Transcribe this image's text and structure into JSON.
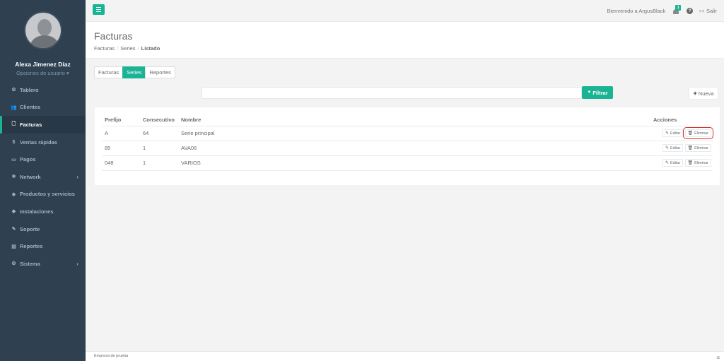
{
  "sidebar": {
    "user_name": "Alexa Jimenez Díaz",
    "user_options": "Opciones de usuario ▾",
    "items": [
      {
        "icon": "⚙",
        "label": "Tablero"
      },
      {
        "icon": "👥",
        "label": "Clientes"
      },
      {
        "icon": "🗋",
        "label": "Facturas"
      },
      {
        "icon": "$",
        "label": "Ventas rápidas"
      },
      {
        "icon": "▭",
        "label": "Pagos"
      },
      {
        "icon": "❄",
        "label": "Network",
        "chevron": "‹"
      },
      {
        "icon": "◈",
        "label": "Productos y servicios"
      },
      {
        "icon": "◆",
        "label": "Instalaciones"
      },
      {
        "icon": "✎",
        "label": "Soporte"
      },
      {
        "icon": "▤",
        "label": "Reportes"
      },
      {
        "icon": "⚙",
        "label": "Sistema",
        "chevron": "‹"
      }
    ]
  },
  "topbar": {
    "welcome": "Bienvenido a ArgusBlack",
    "notif_count": "1",
    "help": "?",
    "logout": "Salir",
    "logout_icon": "↦"
  },
  "heading": {
    "title": "Facturas",
    "crumb1": "Facturas",
    "crumb2": "Series",
    "crumb3": "Listado",
    "sep": "/"
  },
  "tabs": [
    "Facturas",
    "Series",
    "Reportes"
  ],
  "filter": {
    "placeholder": "",
    "button": "Filtrar",
    "button_icon": "▼",
    "new_button": "Nueva",
    "new_icon": "+"
  },
  "table": {
    "headers": [
      "Prefijo",
      "Consecutivo",
      "Nombre",
      "Acciones"
    ],
    "rows": [
      {
        "prefijo": "A",
        "consecutivo": "64",
        "nombre": "Serie principal"
      },
      {
        "prefijo": "85",
        "consecutivo": "1",
        "nombre": "AVA06"
      },
      {
        "prefijo": "048",
        "consecutivo": "1",
        "nombre": "VARIOS"
      }
    ],
    "edit_label": "Editar",
    "edit_icon": "✎",
    "delete_label": "Eliminar",
    "delete_icon": "🗑"
  },
  "footer": {
    "company": "Empresa de prueba",
    "icon": "≡"
  },
  "colors": {
    "accent": "#1ab394",
    "sidebar_bg": "#2f4050",
    "highlight": "#d9302b"
  }
}
